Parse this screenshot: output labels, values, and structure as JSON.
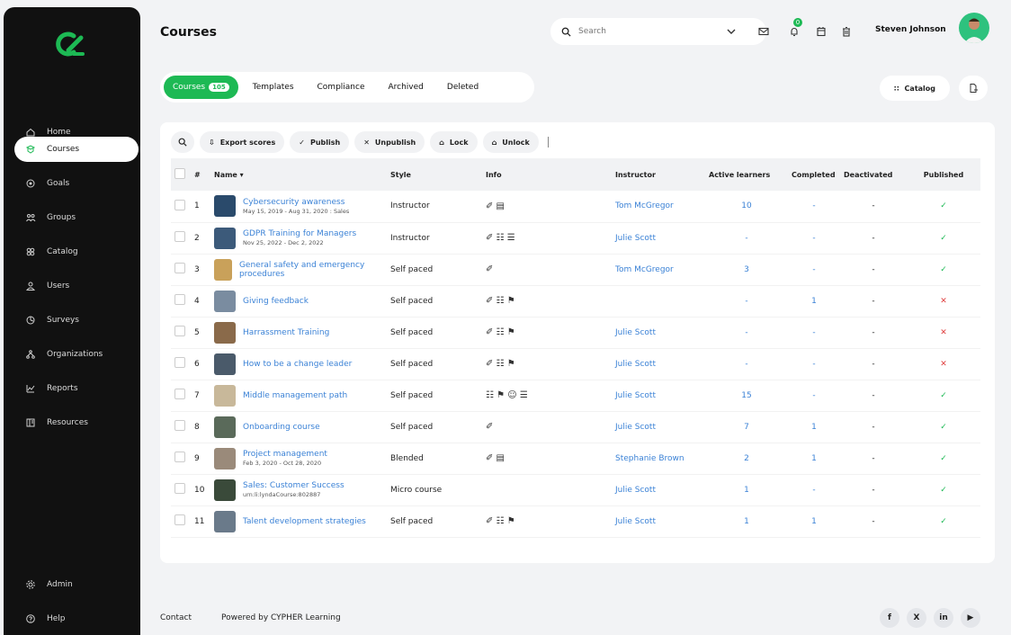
{
  "sidebar": {
    "items": [
      {
        "label": "Home",
        "icon": "home-icon"
      },
      {
        "label": "Courses",
        "icon": "courses-icon",
        "active": true
      },
      {
        "label": "Goals",
        "icon": "goals-icon"
      },
      {
        "label": "Groups",
        "icon": "groups-icon"
      },
      {
        "label": "Catalog",
        "icon": "catalog-icon"
      },
      {
        "label": "Users",
        "icon": "users-icon"
      },
      {
        "label": "Surveys",
        "icon": "surveys-icon"
      },
      {
        "label": "Organizations",
        "icon": "organizations-icon"
      },
      {
        "label": "Reports",
        "icon": "reports-icon"
      },
      {
        "label": "Resources",
        "icon": "resources-icon"
      }
    ],
    "bottom_items": [
      {
        "label": "Admin",
        "icon": "admin-icon"
      },
      {
        "label": "Help",
        "icon": "help-icon"
      }
    ]
  },
  "header": {
    "title": "Courses",
    "search_placeholder": "Search",
    "notification_count": "0",
    "user_name": "Steven Johnson"
  },
  "tabs": [
    {
      "label": "Courses",
      "count": "105",
      "active": true
    },
    {
      "label": "Templates"
    },
    {
      "label": "Compliance"
    },
    {
      "label": "Archived"
    },
    {
      "label": "Deleted"
    }
  ],
  "actions": {
    "catalog_label": "Catalog"
  },
  "toolbar": {
    "export_label": "Export scores",
    "publish_label": "Publish",
    "unpublish_label": "Unpublish",
    "lock_label": "Lock",
    "unlock_label": "Unlock"
  },
  "table": {
    "headers": {
      "num": "#",
      "name": "Name",
      "style": "Style",
      "info": "Info",
      "instructor": "Instructor",
      "active": "Active learners",
      "completed": "Completed",
      "deactivated": "Deactivated",
      "published": "Published"
    },
    "rows": [
      {
        "num": "1",
        "name": "Cybersecurity awareness",
        "sub": "May 15, 2019 - Aug 31, 2020 : Sales",
        "style": "Instructor",
        "info": "✐ ▤",
        "instructor": "Tom McGregor",
        "active": "10",
        "completed": "-",
        "deactivated": "-",
        "published": "✓",
        "thumb": "#2a4a6b"
      },
      {
        "num": "2",
        "name": "GDPR Training for Managers",
        "sub": "Nov 25, 2022 - Dec 2, 2022",
        "style": "Instructor",
        "info": "✐ ☷ ☰",
        "instructor": "Julie Scott",
        "active": "-",
        "completed": "-",
        "deactivated": "-",
        "published": "✓",
        "thumb": "#3c5a7a"
      },
      {
        "num": "3",
        "name": "General safety and emergency procedures",
        "sub": "",
        "style": "Self paced",
        "info": "✐",
        "instructor": "Tom McGregor",
        "active": "3",
        "completed": "-",
        "deactivated": "-",
        "published": "✓",
        "thumb": "#c9a15a"
      },
      {
        "num": "4",
        "name": "Giving feedback",
        "sub": "",
        "style": "Self paced",
        "info": "✐ ☷ ⚑",
        "instructor": "",
        "active": "-",
        "completed": "1",
        "deactivated": "-",
        "published": "✕",
        "thumb": "#7a8ca0"
      },
      {
        "num": "5",
        "name": "Harrassment Training",
        "sub": "",
        "style": "Self paced",
        "info": "✐ ☷ ⚑",
        "instructor": "Julie Scott",
        "active": "-",
        "completed": "-",
        "deactivated": "-",
        "published": "✕",
        "thumb": "#8a6a4a"
      },
      {
        "num": "6",
        "name": "How to be a change leader",
        "sub": "",
        "style": "Self paced",
        "info": "✐ ☷ ⚑",
        "instructor": "Julie Scott",
        "active": "-",
        "completed": "-",
        "deactivated": "-",
        "published": "✕",
        "thumb": "#4a5a6a"
      },
      {
        "num": "7",
        "name": "Middle management path",
        "sub": "",
        "style": "Self paced",
        "info": "☷ ⚑ ☺ ☰",
        "instructor": "Julie Scott",
        "active": "15",
        "completed": "-",
        "deactivated": "-",
        "published": "✓",
        "thumb": "#c8b89a"
      },
      {
        "num": "8",
        "name": "Onboarding course",
        "sub": "",
        "style": "Self paced",
        "info": "✐",
        "instructor": "Julie Scott",
        "active": "7",
        "completed": "1",
        "deactivated": "-",
        "published": "✓",
        "thumb": "#5a6a5a"
      },
      {
        "num": "9",
        "name": "Project management",
        "sub": "Feb 3, 2020 - Oct 28, 2020",
        "style": "Blended",
        "info": "✐ ▤",
        "instructor": "Stephanie Brown",
        "active": "2",
        "completed": "1",
        "deactivated": "-",
        "published": "✓",
        "thumb": "#9a8a7a"
      },
      {
        "num": "10",
        "name": "Sales: Customer Success",
        "sub": "urn:li:lyndaCourse:802887",
        "style": "Micro course",
        "info": "",
        "instructor": "Julie Scott",
        "active": "1",
        "completed": "-",
        "deactivated": "-",
        "published": "✓",
        "thumb": "#3a4a3a"
      },
      {
        "num": "11",
        "name": "Talent development strategies",
        "sub": "",
        "style": "Self paced",
        "info": "✐ ☷ ⚑",
        "instructor": "Julie Scott",
        "active": "1",
        "completed": "1",
        "deactivated": "-",
        "published": "✓",
        "thumb": "#6a7a8a"
      }
    ]
  },
  "footer": {
    "contact": "Contact",
    "powered": "Powered by CYPHER Learning",
    "social": [
      "f",
      "X",
      "in",
      "▶"
    ]
  },
  "colors": {
    "accent": "#1db954",
    "link": "#3b82d6",
    "danger": "#e04040",
    "sidebar": "#111111"
  }
}
